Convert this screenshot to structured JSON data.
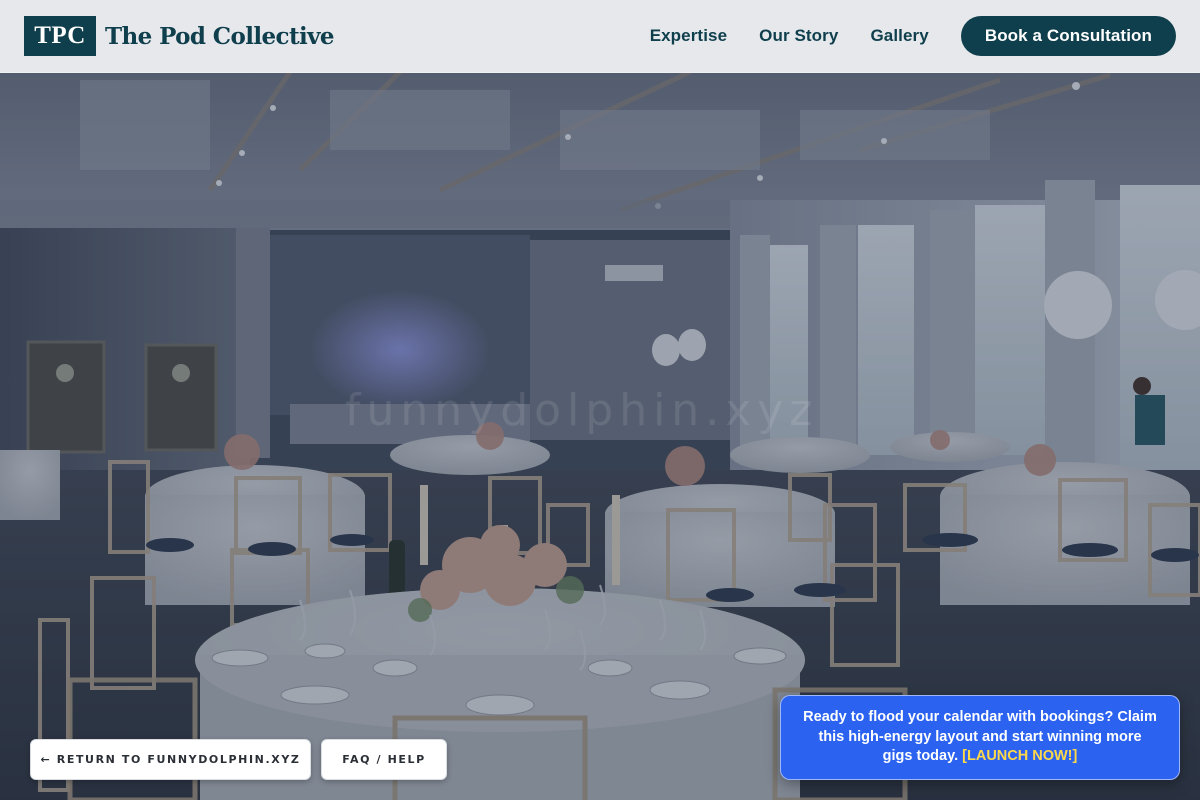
{
  "brand": {
    "mark": "TPC",
    "name": "The Pod Collective"
  },
  "nav": {
    "links": [
      "Expertise",
      "Our Story",
      "Gallery"
    ],
    "cta": "Book a Consultation"
  },
  "footer_pills": {
    "return_label": "← RETURN TO FUNNYDOLPHIN.XYZ",
    "faq_label": "FAQ / HELP"
  },
  "promo": {
    "text": "Ready to flood your calendar with bookings? Claim this high-energy layout and start winning more gigs today.",
    "link_label": "[LAUNCH NOW!]"
  },
  "hero": {
    "watermark": "funnydolphin.xyz"
  },
  "colors": {
    "brand": "#0f3f4c",
    "header_bg": "#eceef1",
    "promo_bg": "#2b63f0",
    "promo_link": "#ffd84a",
    "overlay": "#2f3b4f"
  }
}
